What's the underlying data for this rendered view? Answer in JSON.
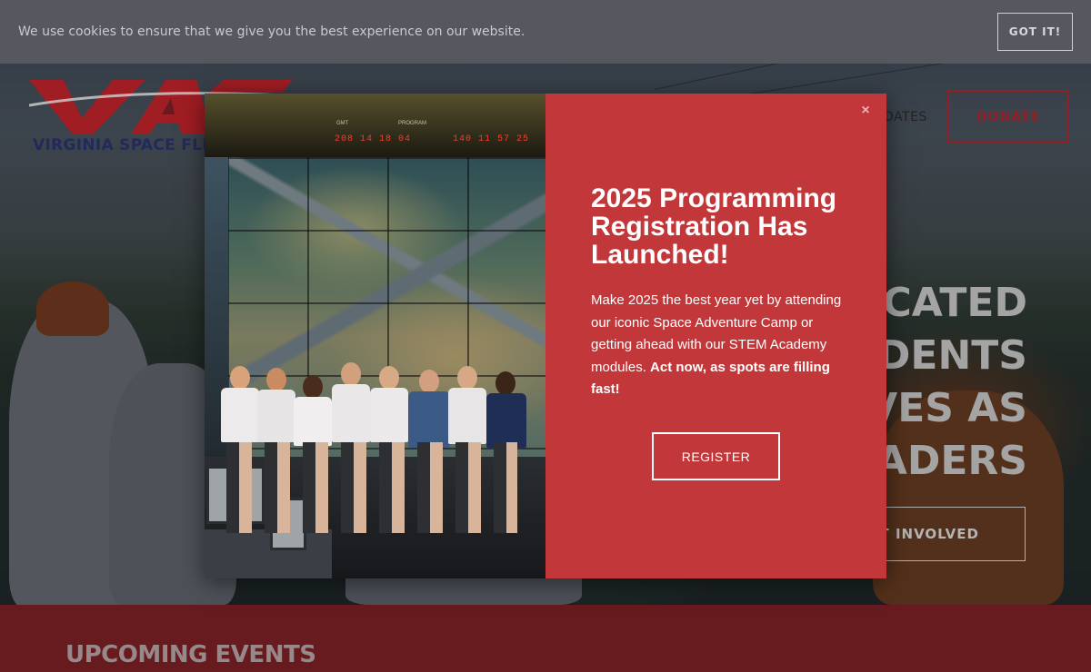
{
  "cookie_bar": {
    "message": "We use cookies to ensure that we give you the best experience on our website.",
    "accept_label": "GOT IT!"
  },
  "header": {
    "logo_text": "VIRGINIA SPACE FLIG",
    "nav_partial": "DATES",
    "donate_label": "DONATE"
  },
  "hero": {
    "headline_lines": [
      "CATED",
      "UDENTS",
      "VES AS",
      "EADERS"
    ],
    "cta_label": "T INVOLVED"
  },
  "events": {
    "title": "UPCOMING EVENTS"
  },
  "modal": {
    "close_symbol": "×",
    "title": "2025 Programming Registration Has Launched!",
    "body_text": "Make 2025 the best year yet by attending our iconic Space Adventure Camp or getting ahead with our STEM Academy modules. ",
    "body_emphasis": "Act now, as spots are filling fast!",
    "register_label": "REGISTER",
    "photo": {
      "clock_left": "208 14 18 04",
      "clock_right": "140 11 57 25",
      "label_gmt": "GMT",
      "label_program": "PROGRAM"
    }
  },
  "colors": {
    "modal_panel": "#c1373a",
    "cookie_bar": "#575760",
    "donate_accent": "#b3262c",
    "events_band": "#7e2226",
    "logo_red": "#c2242b",
    "logo_navy": "#2b3370"
  }
}
